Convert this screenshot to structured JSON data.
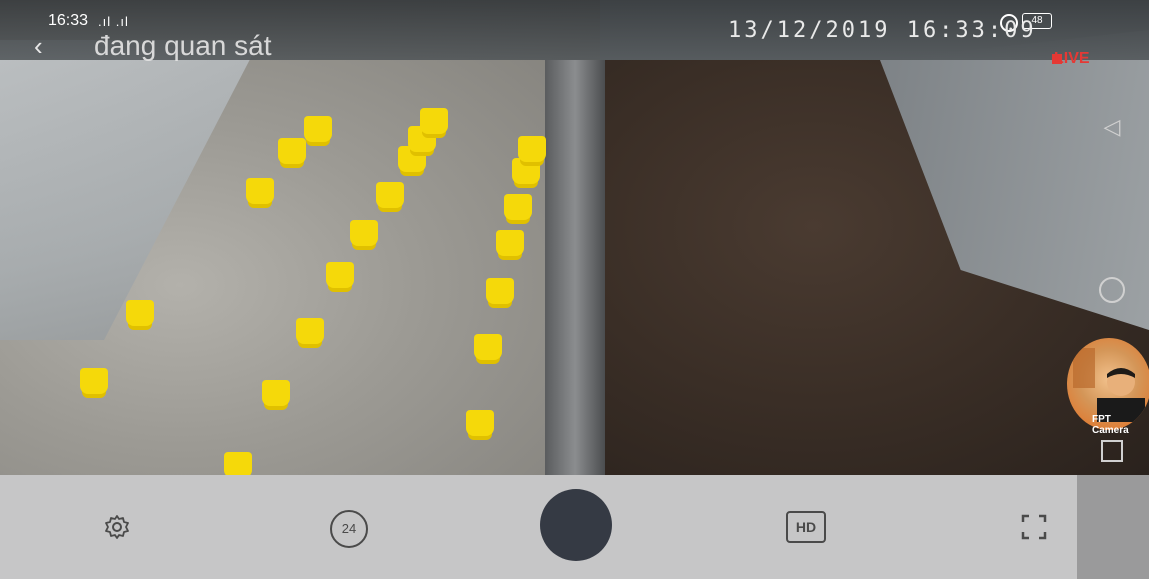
{
  "status_bar": {
    "time": "16:33",
    "signal": ".ıl .ıl",
    "battery": "48"
  },
  "header": {
    "title": "đang quan sát",
    "osd_timestamp": "13/12/2019 16:33:09",
    "live_label": "LIVE"
  },
  "avatar": {
    "brand_text": "FPT Camera"
  },
  "controls": {
    "replay_label": "24",
    "quality_label": "HD"
  },
  "icons": {
    "back": "back-arrow-icon",
    "settings": "gear-icon",
    "replay": "replay-24h-icon",
    "record": "record-button",
    "quality": "hd-icon",
    "fullscreen": "fullscreen-icon",
    "nav_back": "triangle-back-icon",
    "nav_home": "circle-home-icon",
    "nav_recent": "square-recent-icon"
  }
}
